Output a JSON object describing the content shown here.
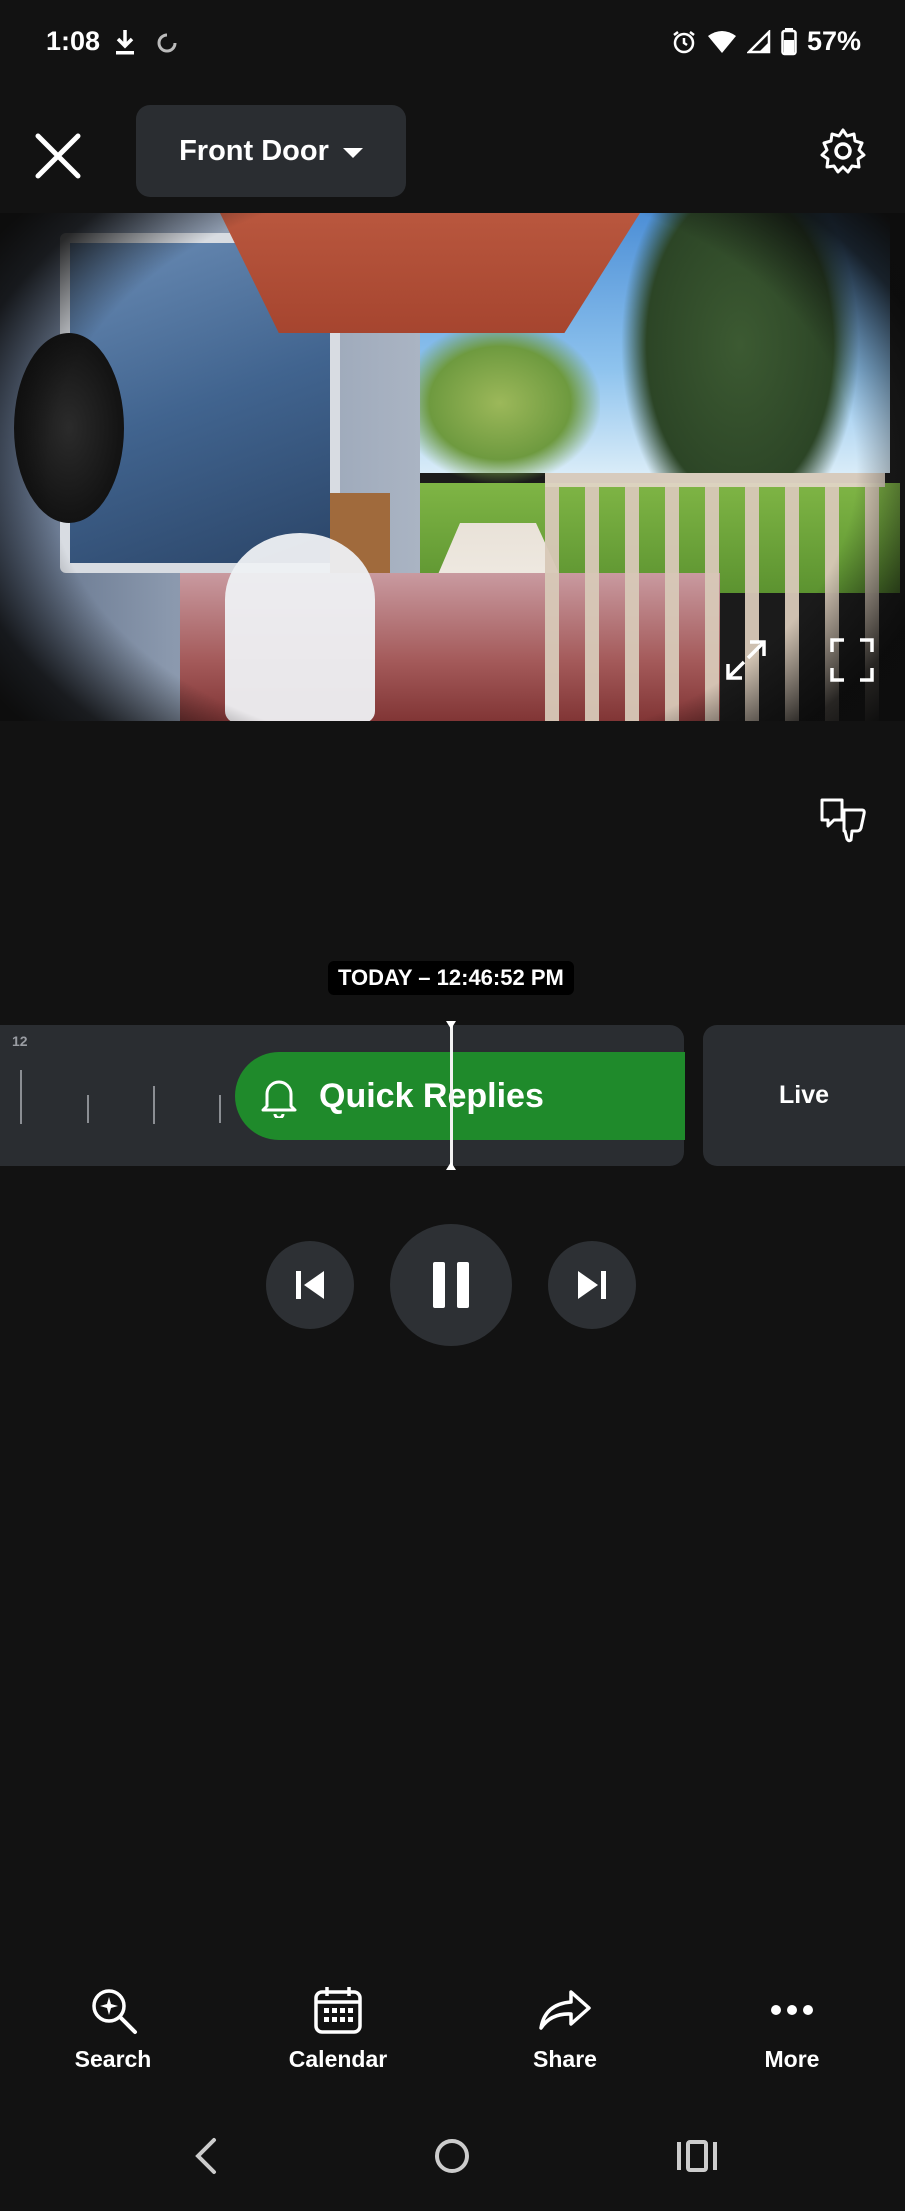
{
  "status_bar": {
    "time": "1:08",
    "battery": "57%",
    "icons": [
      "download-icon",
      "sync-icon",
      "alarm-icon",
      "wifi-icon",
      "signal-icon",
      "battery-icon"
    ]
  },
  "header": {
    "device_name": "Front Door"
  },
  "timeline": {
    "timestamp": "TODAY – 12:46:52 PM",
    "hour_label": "12",
    "event_label": "Quick Replies",
    "live_label": "Live"
  },
  "actions": {
    "search": "Search",
    "calendar": "Calendar",
    "share": "Share",
    "more": "More"
  },
  "colors": {
    "background": "#121212",
    "panel": "#2a2d31",
    "event_green": "#1f8a2b"
  }
}
